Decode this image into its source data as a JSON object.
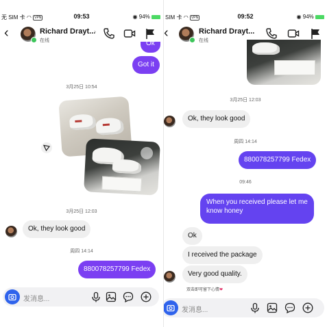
{
  "left_screen": {
    "status": {
      "carrier": "无 SIM 卡",
      "vpn": "VPN",
      "time": "09:53",
      "battery": "94%"
    },
    "header": {
      "name": "Richard Drayt...",
      "status": "在线"
    },
    "messages": {
      "partial_out": "Ok",
      "got_it": "Got it",
      "time1": "3月25日 10:54",
      "time2": "3月25日 12:03",
      "look_good": "Ok, they look good",
      "time3": "周四 14:14",
      "tracking": "880078257799 Fedex"
    },
    "composer": {
      "placeholder": "发消息..."
    }
  },
  "right_screen": {
    "status": {
      "carrier": "SIM 卡",
      "vpn": "VPN",
      "time": "09:52",
      "battery": "94%"
    },
    "header": {
      "name": "Richard Drayt...",
      "status": "在线"
    },
    "messages": {
      "time1": "3月25日 12:03",
      "look_good": "Ok, they look good",
      "time2": "周四 14:14",
      "tracking": "880078257799 Fedex",
      "time3": "09:46",
      "received_line1": "When you received please let me",
      "received_line2": "know honey",
      "ok": "Ok",
      "package": "I received the package",
      "quality": "Very good quality.",
      "hint": "双击即可留下心情",
      "heart": "❤"
    },
    "composer": {
      "placeholder": "发消息..."
    }
  },
  "colors": {
    "outgoing": "#7b3ff2",
    "incoming": "#efefef",
    "camera": "#2f63ec",
    "online": "#3cc55a"
  }
}
